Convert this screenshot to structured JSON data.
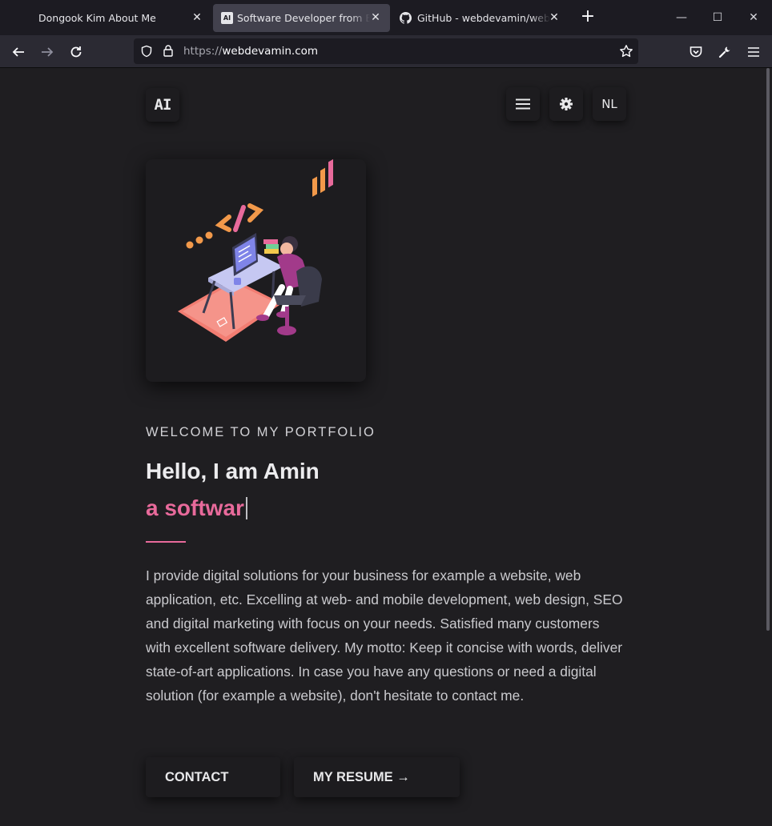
{
  "browser": {
    "tabs": [
      {
        "title": "Dongook Kim About Me"
      },
      {
        "title": "Software Developer from Bruges",
        "favicon": "AI"
      },
      {
        "title": "GitHub - webdevamin/webdevamin"
      }
    ],
    "url_protocol": "https://",
    "url_host": "webdevamin.com"
  },
  "header": {
    "logo_text": "AI",
    "lang_label": "NL"
  },
  "hero": {
    "eyebrow": "WELCOME TO MY PORTFOLIO",
    "heading": "Hello, I am Amin",
    "typed_text": "a softwar",
    "bio": "I provide digital solutions for your business for example a website, web application, etc. Excelling at web- and mobile development, web design, SEO and digital marketing with focus on your needs. Satisfied many customers with excellent software delivery. My motto: Keep it concise with words, deliver state-of-art applications. In case you have any questions or need a digital solution (for example a website), don't hesitate to contact me.",
    "contact_label": "CONTACT",
    "resume_label": "MY RESUME →"
  },
  "colors": {
    "accent": "#e86a9b",
    "background": "#1f1e21",
    "card": "#1d1c1f"
  }
}
